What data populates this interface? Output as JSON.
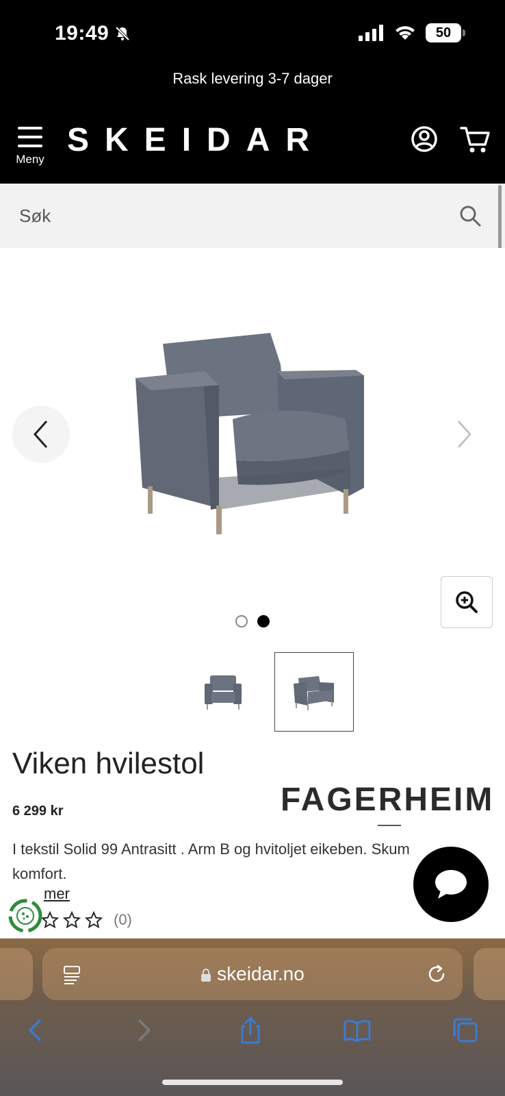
{
  "status_bar": {
    "time": "19:49",
    "battery": "50"
  },
  "promo": {
    "text": "Rask levering 3-7 dager"
  },
  "header": {
    "menu_label": "Meny",
    "logo": "SKEIDAR"
  },
  "search": {
    "placeholder": "Søk"
  },
  "gallery": {
    "current_slide": 2,
    "total_slides": 2
  },
  "product": {
    "title": "Viken hvilestol",
    "price": "6 299 kr",
    "brand": "FAGERHEIM",
    "description": "I tekstil Solid 99 Antrasitt . Arm B og hvitoljet eikeben. Skum komfort.",
    "read_more": "mer",
    "rating_count": "(0)"
  },
  "browser": {
    "url": "skeidar.no"
  },
  "colors": {
    "header_bg": "#000000",
    "search_bg": "#f2f2f2",
    "chair": "#5f6675",
    "accent_blue": "#3a7bd5"
  }
}
